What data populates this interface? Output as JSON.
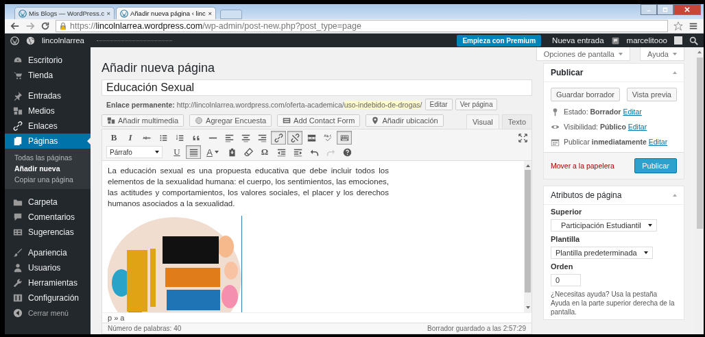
{
  "browser": {
    "tabs": [
      {
        "title": "Mis Blogs — WordPress.c",
        "close": "×",
        "selected": false
      },
      {
        "title": "Añadir nueva página ‹ linc",
        "close": "×",
        "selected": true
      }
    ],
    "url": {
      "scheme": "https://",
      "host": "lincolnlarrea.wordpress.com",
      "path": "/wp-admin/post-new.php?post_type=page"
    }
  },
  "admin_bar": {
    "site": "lincolnlarrea",
    "premium": "Empieza con Premium",
    "new_post": "Nueva entrada",
    "user": "marcelitooo"
  },
  "sidebar": {
    "groups": [
      {
        "items": [
          {
            "label": "Escritorio",
            "selected": false
          },
          {
            "label": "Tienda",
            "selected": false
          }
        ]
      },
      {
        "items": [
          {
            "label": "Entradas",
            "selected": false
          },
          {
            "label": "Medios",
            "selected": false
          },
          {
            "label": "Enlaces",
            "selected": false
          },
          {
            "label": "Páginas",
            "selected": true,
            "children": [
              {
                "label": "Todas las páginas",
                "selected": false
              },
              {
                "label": "Añadir nueva",
                "selected": true
              },
              {
                "label": "Copiar una página",
                "selected": false
              }
            ]
          }
        ]
      },
      {
        "items": [
          {
            "label": "Carpeta",
            "selected": false
          },
          {
            "label": "Comentarios",
            "selected": false
          },
          {
            "label": "Sugerencias",
            "selected": false
          }
        ]
      },
      {
        "items": [
          {
            "label": "Apariencia",
            "selected": false
          },
          {
            "label": "Usuarios",
            "selected": false
          },
          {
            "label": "Herramientas",
            "selected": false
          },
          {
            "label": "Configuración",
            "selected": false
          },
          {
            "label": "Cerrar menú",
            "selected": false,
            "kind": "collapse"
          }
        ]
      }
    ]
  },
  "screen_tabs": [
    "Opciones de pantalla",
    "Ayuda"
  ],
  "page_title": "Añadir nueva página",
  "editor": {
    "title": "Educación Sexual",
    "permalink": {
      "label": "Enlace permanente:",
      "base": "http://lincolnlarrea.wordpress.com/oferta-academica/",
      "slug": "uso-indebido-de-drogas",
      "end": "/",
      "buttons": [
        "Editar",
        "Ver página"
      ]
    },
    "media_buttons": [
      "Añadir multimedia",
      "Agregar Encuesta",
      "Add Contact Form",
      "Añadir ubicación"
    ],
    "mode_tabs": [
      {
        "label": "Visual",
        "selected": true
      },
      {
        "label": "Texto",
        "selected": false
      }
    ],
    "toolbar_1": [
      {
        "glyph": "B",
        "pressed": false
      },
      {
        "glyph": "I",
        "pressed": false
      },
      {
        "pressed": false
      },
      {
        "pressed": false
      },
      {
        "pressed": false
      },
      {
        "pressed": false
      },
      {
        "pressed": false
      },
      {
        "pressed": false
      },
      {
        "pressed": false
      },
      {
        "pressed": false
      },
      {
        "pressed": true
      },
      {
        "pressed": true
      },
      {
        "pressed": false
      },
      {
        "pressed": false
      },
      {
        "pressed": true
      }
    ],
    "format": "Párrafo",
    "toolbar_2": [
      {
        "glyph": "U",
        "pressed": false
      },
      {
        "pressed": true
      },
      {
        "glyph": "A",
        "pressed": false
      },
      {
        "pressed": false
      },
      {
        "pressed": false
      },
      {
        "glyph": "Ω",
        "pressed": false
      },
      {
        "pressed": false
      },
      {
        "pressed": false
      },
      {
        "pressed": false
      },
      {
        "pressed": false,
        "disabled": true
      },
      {
        "pressed": false
      }
    ],
    "content": "La educación sexual es una propuesta educativa que debe incluir todos los elementos de la sexualidad humana: el cuerpo, los sentimientos, las emociones, las actitudes y  comportamientos, los valores sociales, el placer y los derechos humanos asociados a la sexualidad.",
    "image": {
      "kind": "picture"
    },
    "path": "p » a",
    "word_count": "Número de palabras: 40",
    "saved": "Borrador guardado a las 2:57:29"
  },
  "publish": {
    "title": "Publicar",
    "save_draft": "Guardar borrador",
    "preview": "Vista previa",
    "rows": [
      {
        "label": "Estado:",
        "value": "Borrador",
        "link": "Editar"
      },
      {
        "label": "Visibilidad:",
        "value": "Público",
        "link": "Editar"
      },
      {
        "label": "Publicar",
        "value": "inmediatamente",
        "link": "Editar"
      }
    ],
    "trash": "Mover a la papelera",
    "publish": "Publicar"
  },
  "attributes": {
    "title": "Atributos de página",
    "parent_label": "Superior",
    "parent_value": "Participación Estudiantil",
    "template_label": "Plantilla",
    "template_value": "Plantilla predeterminada",
    "order_label": "Orden",
    "order_value": "0",
    "help": "¿Necesitas ayuda? Usa la pestaña Ayuda en la parte superior derecha de la pantalla."
  }
}
